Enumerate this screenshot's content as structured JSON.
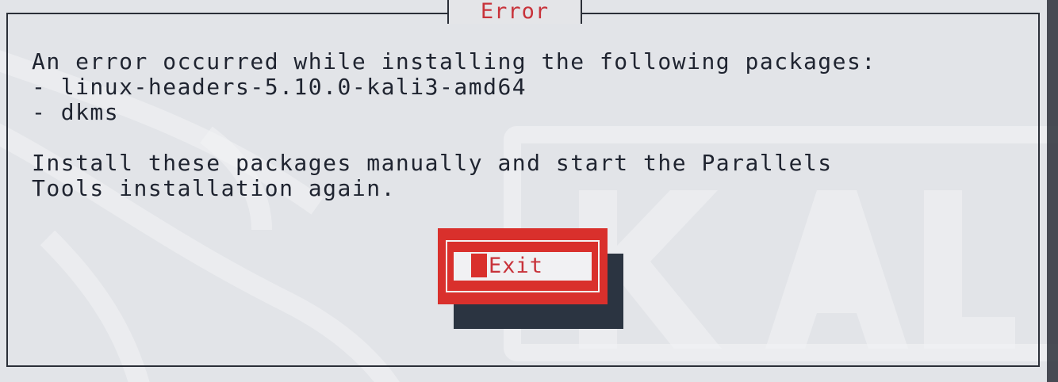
{
  "dialog": {
    "title": "Error",
    "message_lines": [
      "An error occurred while installing the following packages:",
      "- linux-headers-5.10.0-kali3-amd64",
      "- dkms",
      "Install these packages manually and start the Parallels",
      "Tools installation again."
    ],
    "exit_button_label": "Exit"
  },
  "colors": {
    "accent": "#d9302c",
    "title_text": "#c8323a",
    "body_text": "#1f2430",
    "frame": "#2b2f38",
    "background": "#dcdee2"
  },
  "icons": {
    "watermark": "kali-dragon-logo"
  }
}
